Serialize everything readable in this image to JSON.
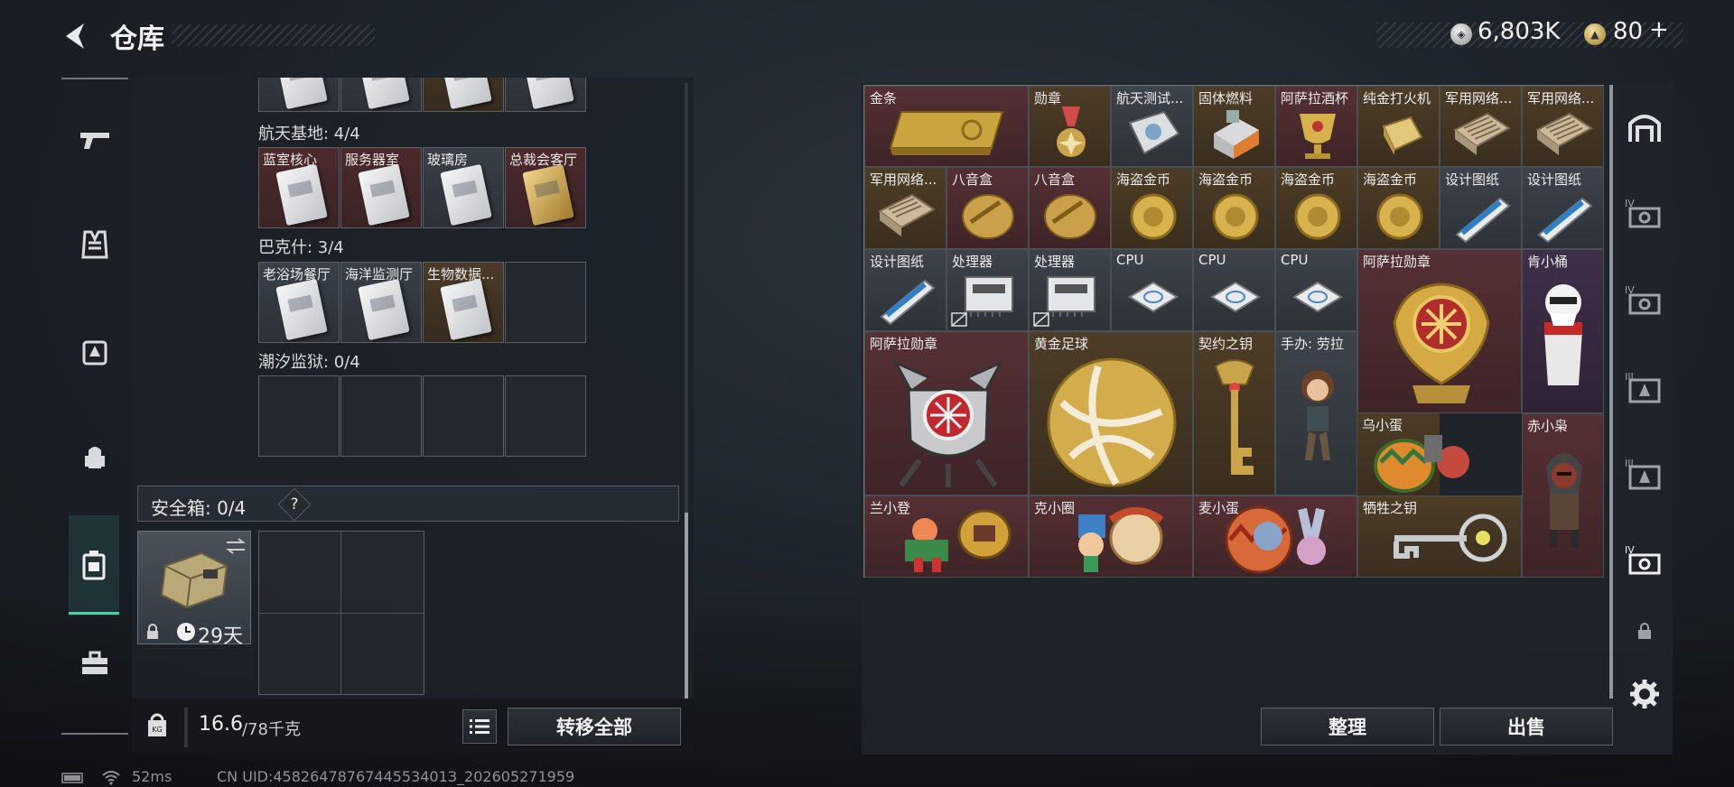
{
  "header": {
    "title": "仓库",
    "silver_value": "6,803K",
    "gold_value": "80",
    "gold_plus": "+"
  },
  "left_sections": [
    {
      "label": "航天基地: 4/4",
      "slots": [
        "蓝室核心",
        "服务器室",
        "玻璃房",
        "总裁会客厅"
      ]
    },
    {
      "label": "巴克什: 3/4",
      "slots": [
        "老浴场餐厅",
        "海洋监测厅",
        "生物数据..."
      ]
    },
    {
      "label": "潮汐监狱: 0/4"
    }
  ],
  "safe": {
    "header": "安全箱: 0/4",
    "help": "?",
    "timer": "29天"
  },
  "weight": {
    "current": "16.6",
    "max": "/78千克"
  },
  "buttons": {
    "transfer_all": "转移全部",
    "sort": "整理",
    "sell": "出售"
  },
  "items": [
    "金条",
    "勋章",
    "航天测试...",
    "固体燃料",
    "阿萨拉酒杯",
    "纯金打火机",
    "军用网络...",
    "军用网络...",
    "军用网络...",
    "八音盒",
    "八音盒",
    "海盗金币",
    "海盗金币",
    "海盗金币",
    "海盗金币",
    "设计图纸",
    "设计图纸",
    "设计图纸",
    "处理器",
    "处理器",
    "CPU",
    "CPU",
    "CPU",
    "阿萨拉勋章",
    "肯小桶",
    "阿萨拉勋章",
    "黄金足球",
    "契约之钥",
    "手办: 劳拉",
    "乌小蛋",
    "赤小枭",
    "兰小登",
    "克小圈",
    "麦小蛋",
    "牺牲之钥"
  ],
  "status": {
    "ping": "52ms",
    "uid": "CN UID:4582647876744553401З_202605271959"
  },
  "colors": {
    "accent": "#3fd6b0",
    "red_rarity": "#553034",
    "gold_rarity": "#4d3d27"
  }
}
